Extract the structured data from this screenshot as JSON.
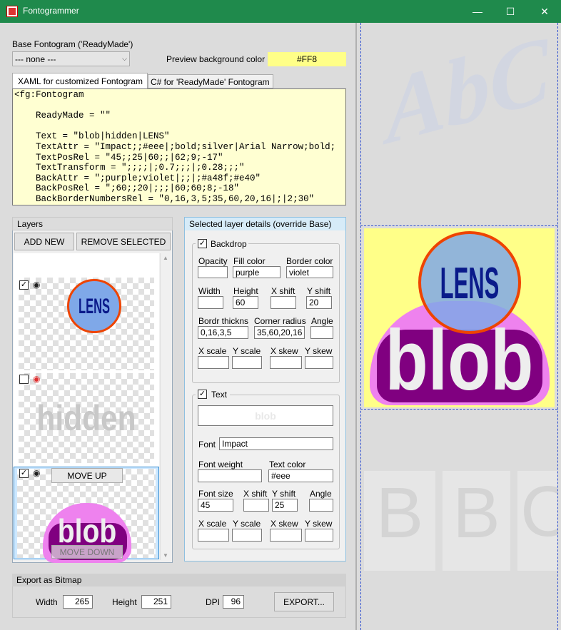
{
  "window": {
    "title": "Fontogrammer",
    "minimize_glyph": "—",
    "maximize_glyph": "☐",
    "close_glyph": "✕"
  },
  "base": {
    "label": "Base Fontogram ('ReadyMade')",
    "selected": "--- none ---"
  },
  "preview_bg": {
    "label": "Preview background color",
    "value": "#FF8"
  },
  "tabs": [
    {
      "label": "XAML for customized Fontogram",
      "active": true
    },
    {
      "label": "C# for 'ReadyMade' Fontogram",
      "active": false
    }
  ],
  "xml_text": "<fg:Fontogram\n\n    ReadyMade = \"\"\n\n    Text = \"blob|hidden|LENS\"\n    TextAttr = \"Impact;;#eee|;bold;silver|Arial Narrow;bold;\n    TextPosRel = \"45;;25|60;;|62;9;-17\"\n    TextTransform = \";;;;|;0.7;;;|;0.28;;;\"\n    BackAttr = \";purple;violet|;;|;#a48f;#e40\"\n    BackPosRel = \";60;;20|;;;|60;60;8;-18\"\n    BackBorderNumbersRel = \"0,16,3,5;35,60,20,16|;|2;30\"",
  "layers": {
    "label": "Layers",
    "add_label": "ADD NEW",
    "remove_label": "REMOVE SELECTED",
    "items": [
      {
        "text": "LENS",
        "checked": true,
        "visible": true
      },
      {
        "text": "hidden",
        "checked": false,
        "visible": false
      },
      {
        "text": "blob",
        "checked": true,
        "visible": true
      }
    ],
    "move_up_label": "MOVE UP",
    "move_down_label": "MOVE DOWN",
    "check_glyph": "✓",
    "eye_glyph": "◉"
  },
  "details": {
    "label": "Selected layer details (override Base)",
    "backdrop": {
      "label": "Backdrop",
      "checked": true,
      "opacity": {
        "label": "Opacity",
        "value": ""
      },
      "fill_color": {
        "label": "Fill color",
        "value": "purple"
      },
      "border_color": {
        "label": "Border color",
        "value": "violet"
      },
      "width": {
        "label": "Width",
        "value": ""
      },
      "height": {
        "label": "Height",
        "value": "60"
      },
      "x_shift": {
        "label": "X shift",
        "value": ""
      },
      "y_shift": {
        "label": "Y shift",
        "value": "20"
      },
      "border_thickness": {
        "label": "Bordr thickns",
        "value": "0,16,3,5"
      },
      "corner_radius": {
        "label": "Corner radius",
        "value": "35,60,20,16"
      },
      "angle": {
        "label": "Angle",
        "value": ""
      },
      "x_scale": {
        "label": "X scale",
        "value": ""
      },
      "y_scale": {
        "label": "Y scale",
        "value": ""
      },
      "x_skew": {
        "label": "X skew",
        "value": ""
      },
      "y_skew": {
        "label": "Y skew",
        "value": ""
      }
    },
    "text": {
      "label": "Text",
      "checked": true,
      "preview": "blob",
      "font": {
        "label": "Font",
        "value": "Impact"
      },
      "font_weight": {
        "label": "Font weight",
        "value": ""
      },
      "text_color": {
        "label": "Text color",
        "value": "#eee"
      },
      "font_size": {
        "label": "Font size",
        "value": "45"
      },
      "x_shift": {
        "label": "X shift",
        "value": ""
      },
      "y_shift": {
        "label": "Y shift",
        "value": "25"
      },
      "angle": {
        "label": "Angle",
        "value": ""
      },
      "x_scale": {
        "label": "X scale",
        "value": ""
      },
      "y_scale": {
        "label": "Y scale",
        "value": ""
      },
      "x_skew": {
        "label": "X skew",
        "value": ""
      },
      "y_skew": {
        "label": "Y skew",
        "value": ""
      }
    }
  },
  "export": {
    "label": "Export as Bitmap",
    "width_label": "Width",
    "width": "265",
    "height_label": "Height",
    "height": "251",
    "dpi_label": "DPI",
    "dpi": "96",
    "button_label": "EXPORT..."
  },
  "preview": {
    "top_text": "AbC",
    "main_lens": "LENS",
    "main_blob": "blob",
    "bottom_letters": [
      "B",
      "B",
      "C"
    ]
  },
  "colors": {
    "titlebar": "#1f8a4c",
    "preview_bg": "#ffff88",
    "xml_bg": "#ffffd2",
    "lens_fill": "#7fa8e8",
    "lens_border": "#ee4400",
    "lens_text": "#0a1a8a",
    "blob_back": "#800080",
    "blob_border": "#ee82ee",
    "blob_text": "#eeeeee",
    "guide": "#3050d0"
  }
}
